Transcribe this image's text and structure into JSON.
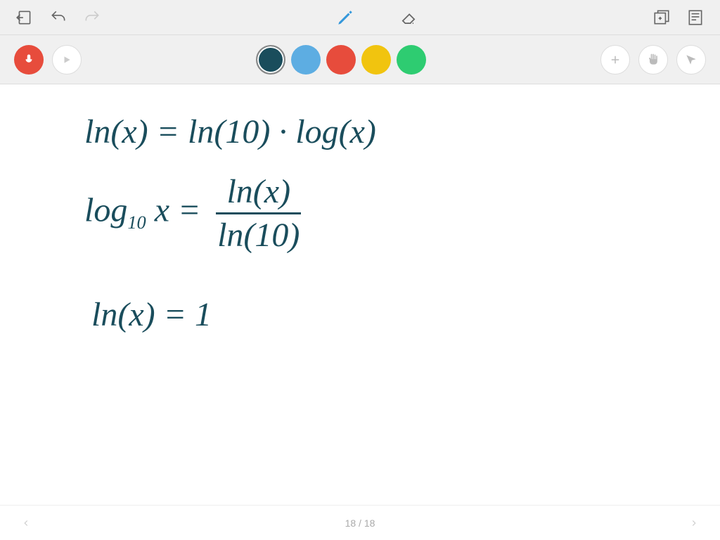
{
  "toolbar": {
    "exit": "exit",
    "undo": "undo",
    "redo": "redo",
    "pen": "pen",
    "eraser": "eraser",
    "layers": "layers",
    "document": "document"
  },
  "controls": {
    "record": "record",
    "play": "play",
    "add": "+",
    "hand": "hand",
    "pointer": "pointer"
  },
  "colors": {
    "selected": "#1a4d5c",
    "palette": [
      "#1a4d5c",
      "#5dade2",
      "#e74c3c",
      "#f1c40f",
      "#2ecc71"
    ]
  },
  "handwriting": {
    "line1_a": "ln(x) = ln(10) · log(x)",
    "line2_left": "log",
    "line2_sub": "10",
    "line2_mid": "x =",
    "line2_num": "ln(x)",
    "line2_den": "ln(10)",
    "line3": "ln(x) = 1"
  },
  "pagination": {
    "text": "18 / 18",
    "current": 18,
    "total": 18
  }
}
